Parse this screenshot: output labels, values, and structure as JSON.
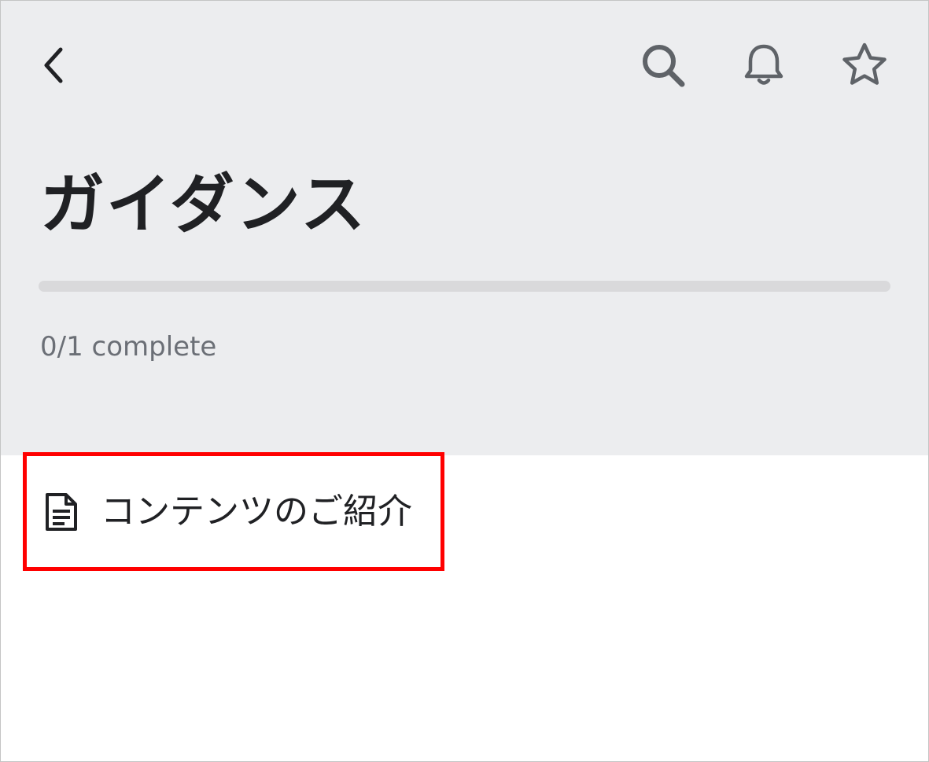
{
  "header": {
    "title": "ガイダンス",
    "progress": {
      "completed": 0,
      "total": 1,
      "text": "0/1 complete"
    }
  },
  "toolbar": {
    "back_icon": "chevron-left-icon",
    "search_icon": "search-icon",
    "notifications_icon": "bell-icon",
    "favorite_icon": "star-icon"
  },
  "items": [
    {
      "icon": "document-icon",
      "label": "コンテンツのご紹介"
    }
  ],
  "colors": {
    "header_background": "#ecedef",
    "highlight_border": "#ff0000",
    "icon_gray": "#5f6368",
    "text_dark": "#202124",
    "text_muted": "#6b6f76"
  }
}
